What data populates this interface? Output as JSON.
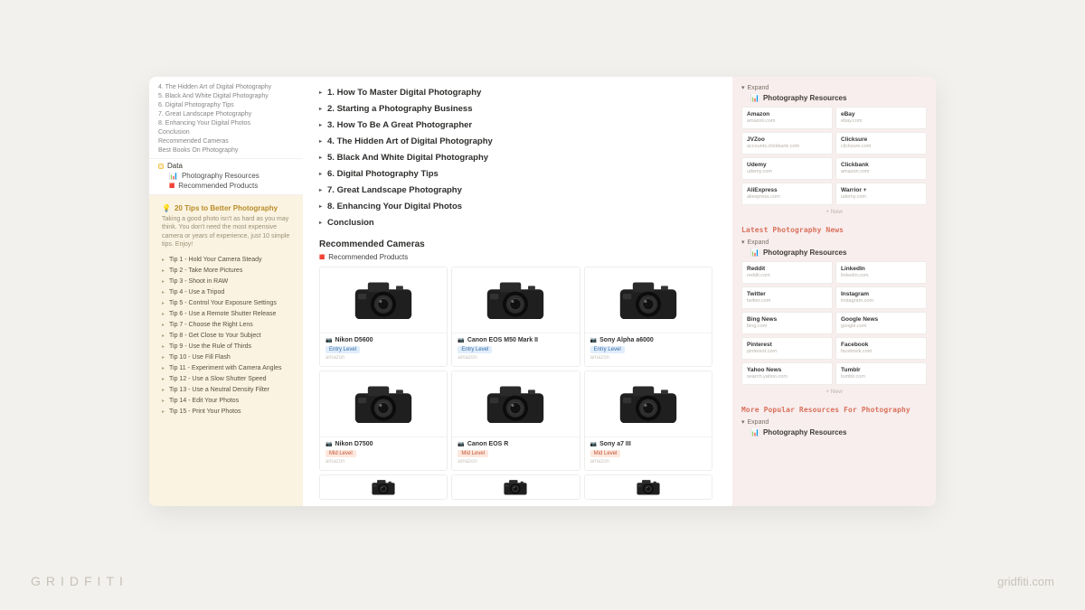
{
  "brand": {
    "left": "GRIDFITI",
    "right": "gridfiti.com"
  },
  "sidebar": {
    "nav": [
      "4. The Hidden Art of Digital Photography",
      "5. Black And White Digital Photography",
      "6. Digital Photography Tips",
      "7. Great Landscape Photography",
      "8. Enhancing Your Digital Photos",
      "Conclusion",
      "Recommended Cameras",
      "Best Books On Photography"
    ],
    "data_label": "Data",
    "res_label": "Photography Resources",
    "rec_label": "Recommended Products"
  },
  "tips": {
    "title": "20 Tips to Better Photography",
    "desc": "Taking a good photo isn't as hard as you may think. You don't need the most expensive camera or years of experience, just 10 simple tips. Enjoy!",
    "items": [
      "Tip 1 - Hold Your Camera Steady",
      "Tip 2 - Take More Pictures",
      "Tip 3 - Shoot in RAW",
      "Tip 4 - Use a Tripod",
      "Tip 5 - Control Your Exposure Settings",
      "Tip 6 - Use a Remote Shutter Release",
      "Tip 7 - Choose the Right Lens",
      "Tip 8 - Get Close to Your Subject",
      "Tip 9 - Use the Rule of Thirds",
      "Tip 10 - Use Fill Flash",
      "Tip 11 - Experiment with Camera Angles",
      "Tip 12 - Use a Slow Shutter Speed",
      "Tip 13 - Use a Neutral Density Filter",
      "Tip 14 - Edit Your Photos",
      "Tip 15 - Print Your Photos"
    ]
  },
  "main": {
    "headings": [
      "1. How To Master Digital Photography",
      "2. Starting a Photography Business",
      "3. How To Be A Great Photographer",
      "4. The Hidden Art of Digital Photography",
      "5. Black And White Digital Photography",
      "6. Digital Photography Tips",
      "7. Great Landscape Photography",
      "8. Enhancing Your Digital Photos",
      "Conclusion"
    ],
    "rec_title": "Recommended Cameras",
    "rec_sub": "Recommended Products",
    "cameras": [
      {
        "name": "Nikon D5600",
        "level": "Entry Level",
        "levelClass": "entry",
        "store": "amazon"
      },
      {
        "name": "Canon EOS M50 Mark II",
        "level": "Entry Level",
        "levelClass": "entry",
        "store": "amazon"
      },
      {
        "name": "Sony Alpha a6000",
        "level": "Entry Level",
        "levelClass": "entry",
        "store": "amazon"
      },
      {
        "name": "Nikon D7500",
        "level": "Mid Level",
        "levelClass": "mid",
        "store": "amazon"
      },
      {
        "name": "Canon EOS R",
        "level": "Mid Level",
        "levelClass": "mid",
        "store": "amazon"
      },
      {
        "name": "Sony a7 III",
        "level": "Mid Level",
        "levelClass": "mid",
        "store": "amazon"
      }
    ]
  },
  "right": {
    "expand": "Expand",
    "res_title": "Photography Resources",
    "new_label": "+ New",
    "block1": [
      {
        "t": "Amazon",
        "u": "amazon.com"
      },
      {
        "t": "eBay",
        "u": "ebay.com"
      },
      {
        "t": "JVZoo",
        "u": "accounts.clickbank.com"
      },
      {
        "t": "Clicksure",
        "u": "clicksure.com"
      },
      {
        "t": "Udemy",
        "u": "udemy.com"
      },
      {
        "t": "Clickbank",
        "u": "amazon.com"
      },
      {
        "t": "AliExpress",
        "u": "aliexpress.com"
      },
      {
        "t": "Warrior +",
        "u": "udemy.com"
      }
    ],
    "sec2_title": "Latest Photography News",
    "block2": [
      {
        "t": "Reddit",
        "u": "reddit.com"
      },
      {
        "t": "LinkedIn",
        "u": "linkedin.com"
      },
      {
        "t": "Twitter",
        "u": "twitter.com"
      },
      {
        "t": "Instagram",
        "u": "instagram.com"
      },
      {
        "t": "Bing News",
        "u": "bing.com"
      },
      {
        "t": "Google News",
        "u": "google.com"
      },
      {
        "t": "Pinterest",
        "u": "pinterest.com"
      },
      {
        "t": "Facebook",
        "u": "facebook.com"
      },
      {
        "t": "Yahoo News",
        "u": "search.yahoo.com"
      },
      {
        "t": "Tumblr",
        "u": "tumblr.com"
      }
    ],
    "sec3_title": "More Popular Resources For Photography"
  }
}
